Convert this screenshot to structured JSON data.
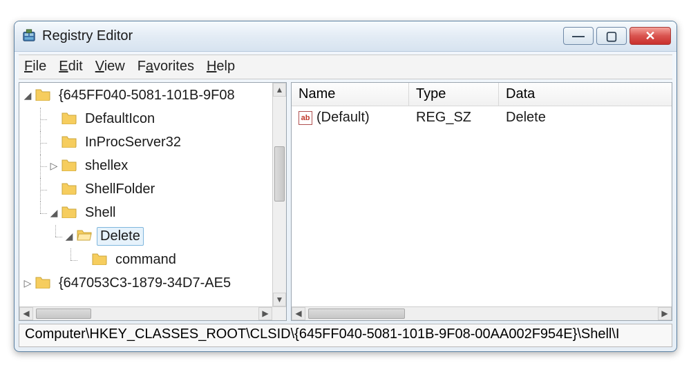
{
  "window": {
    "title": "Registry Editor"
  },
  "menubar": {
    "file": "File",
    "edit": "Edit",
    "view": "View",
    "favorites": "Favorites",
    "help": "Help"
  },
  "tree": {
    "root": {
      "label": "{645FF040-5081-101B-9F08",
      "expanded": true
    },
    "children": [
      {
        "label": "DefaultIcon",
        "expander": "none"
      },
      {
        "label": "InProcServer32",
        "expander": "none"
      },
      {
        "label": "shellex",
        "expander": "collapsed"
      },
      {
        "label": "ShellFolder",
        "expander": "none"
      },
      {
        "label": "Shell",
        "expander": "expanded",
        "children": [
          {
            "label": "Delete",
            "expander": "expanded",
            "selected": true,
            "children": [
              {
                "label": "command",
                "expander": "none"
              }
            ]
          }
        ]
      }
    ],
    "sibling": {
      "label": "{647053C3-1879-34D7-AE5",
      "expander": "collapsed"
    }
  },
  "list": {
    "columns": {
      "name": "Name",
      "type": "Type",
      "data": "Data"
    },
    "rows": [
      {
        "icon": "string-icon",
        "name": "(Default)",
        "type": "REG_SZ",
        "data": "Delete"
      }
    ]
  },
  "statusbar": {
    "path": "Computer\\HKEY_CLASSES_ROOT\\CLSID\\{645FF040-5081-101B-9F08-00AA002F954E}\\Shell\\I"
  },
  "icons": {
    "minimize": "—",
    "maximize": "▢",
    "close": "✕",
    "string_label": "ab"
  }
}
